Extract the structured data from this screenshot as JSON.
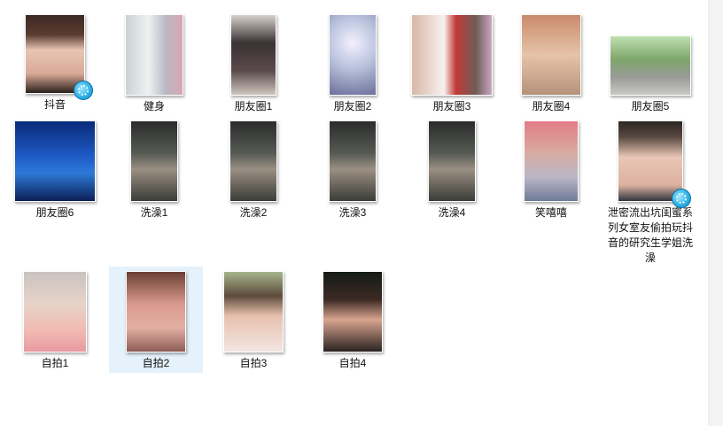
{
  "files": [
    {
      "name": "抖音",
      "kind": "video",
      "thumb": "t-face1"
    },
    {
      "name": "健身",
      "kind": "image",
      "thumb": "t-gym"
    },
    {
      "name": "朋友圈1",
      "kind": "image",
      "thumb": "t-sheer"
    },
    {
      "name": "朋友圈2",
      "kind": "image",
      "thumb": "t-sparkle"
    },
    {
      "name": "朋友圈3",
      "kind": "image",
      "thumb": "t-room"
    },
    {
      "name": "朋友圈4",
      "kind": "image",
      "thumb": "t-wall"
    },
    {
      "name": "朋友圈5",
      "kind": "image",
      "thumb": "t-street"
    },
    {
      "name": "朋友圈6",
      "kind": "image",
      "thumb": "t-blue"
    },
    {
      "name": "洗澡1",
      "kind": "image",
      "thumb": "t-dark"
    },
    {
      "name": "洗澡2",
      "kind": "image",
      "thumb": "t-dark"
    },
    {
      "name": "洗澡3",
      "kind": "image",
      "thumb": "t-dark"
    },
    {
      "name": "洗澡4",
      "kind": "image",
      "thumb": "t-dark"
    },
    {
      "name": "笑嘻嘻",
      "kind": "image",
      "thumb": "t-smile"
    },
    {
      "name": "泄密流出坑闺蜜系列女室友偷拍玩抖音的研究生学姐洗澡",
      "kind": "video",
      "thumb": "t-face2"
    },
    {
      "name": "自拍1",
      "kind": "image",
      "thumb": "t-glasses"
    },
    {
      "name": "自拍2",
      "kind": "image",
      "thumb": "t-pink",
      "selected": true
    },
    {
      "name": "自拍3",
      "kind": "image",
      "thumb": "t-flower"
    },
    {
      "name": "自拍4",
      "kind": "image",
      "thumb": "t-night"
    }
  ]
}
